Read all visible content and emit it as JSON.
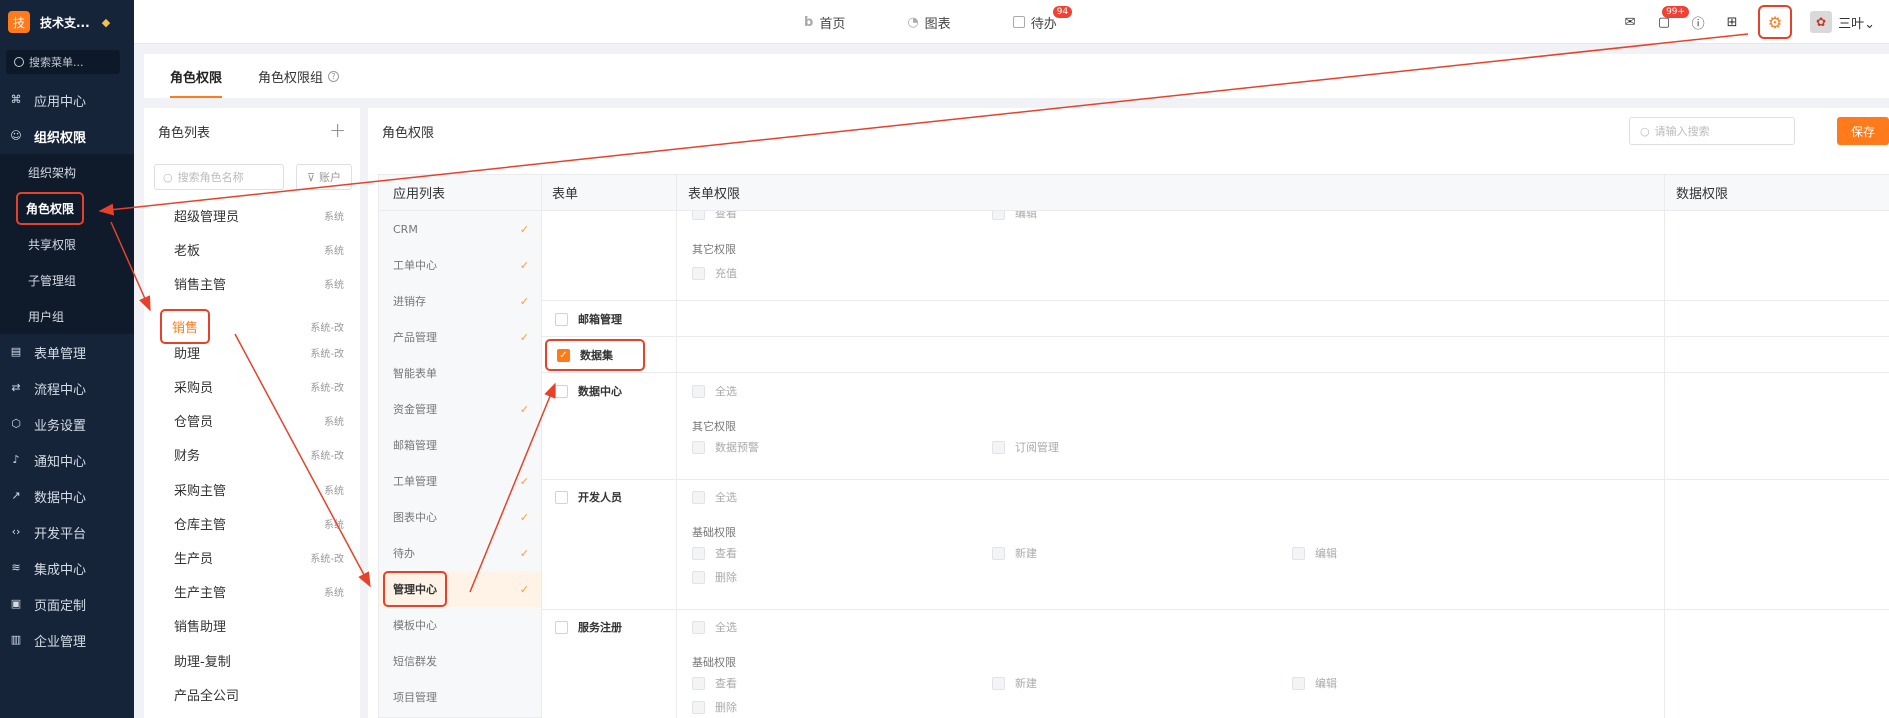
{
  "brand": {
    "logo": "技",
    "name": "技术支...",
    "badge_icon": "diamond-icon"
  },
  "sidebar": {
    "search_placeholder": "搜索菜单...",
    "items": [
      {
        "label": "应用中心",
        "icon": "apps-icon"
      },
      {
        "label": "组织权限",
        "icon": "user-icon"
      },
      {
        "label": "表单管理",
        "icon": "form-icon"
      },
      {
        "label": "流程中心",
        "icon": "flow-icon"
      },
      {
        "label": "业务设置",
        "icon": "cube-icon"
      },
      {
        "label": "通知中心",
        "icon": "bell-icon"
      },
      {
        "label": "数据中心",
        "icon": "chart-icon"
      },
      {
        "label": "开发平台",
        "icon": "code-icon"
      },
      {
        "label": "集成中心",
        "icon": "layers-icon"
      },
      {
        "label": "页面定制",
        "icon": "page-icon"
      },
      {
        "label": "企业管理",
        "icon": "building-icon"
      }
    ],
    "sub_items": [
      "组织架构",
      "角色权限",
      "共享权限",
      "子管理组",
      "用户组"
    ]
  },
  "topnav": {
    "items": [
      {
        "label": "首页",
        "icon": "home-icon"
      },
      {
        "label": "图表",
        "icon": "chart-icon"
      },
      {
        "label": "待办",
        "icon": "todo-icon",
        "badge": "94"
      }
    ],
    "message_badge": "99+",
    "user": "三叶"
  },
  "tabs": [
    "角色权限",
    "角色权限组"
  ],
  "roles": {
    "title": "角色列表",
    "search_placeholder": "搜索角色名称",
    "filter_label": "账户",
    "list": [
      {
        "name": "超级管理员",
        "type": "系统"
      },
      {
        "name": "老板",
        "type": "系统"
      },
      {
        "name": "销售主管",
        "type": "系统"
      },
      {
        "name": "销售",
        "type": "系统-改"
      },
      {
        "name": "助理",
        "type": "系统-改"
      },
      {
        "name": "采购员",
        "type": "系统-改"
      },
      {
        "name": "仓管员",
        "type": "系统"
      },
      {
        "name": "财务",
        "type": "系统-改"
      },
      {
        "name": "采购主管",
        "type": "系统"
      },
      {
        "name": "仓库主管",
        "type": "系统"
      },
      {
        "name": "生产员",
        "type": "系统-改"
      },
      {
        "name": "生产主管",
        "type": "系统"
      },
      {
        "name": "销售助理",
        "type": ""
      },
      {
        "name": "助理-复制",
        "type": ""
      },
      {
        "name": "产品全公司",
        "type": ""
      }
    ]
  },
  "main": {
    "title": "角色权限",
    "search_placeholder": "请输入搜索",
    "save_label": "保存",
    "applist_header": "应用列表",
    "apps": [
      {
        "name": "CRM",
        "checked": true
      },
      {
        "name": "工单中心",
        "checked": true
      },
      {
        "name": "进销存",
        "checked": true
      },
      {
        "name": "产品管理",
        "checked": true
      },
      {
        "name": "智能表单",
        "checked": false
      },
      {
        "name": "资金管理",
        "checked": true
      },
      {
        "name": "邮箱管理",
        "checked": false
      },
      {
        "name": "工单管理",
        "checked": true
      },
      {
        "name": "图表中心",
        "checked": true
      },
      {
        "name": "待办",
        "checked": true
      },
      {
        "name": "管理中心",
        "checked": true
      },
      {
        "name": "模板中心",
        "checked": false
      },
      {
        "name": "短信群发",
        "checked": false
      },
      {
        "name": "项目管理",
        "checked": false
      }
    ],
    "columns": {
      "form": "表单",
      "form_perm": "表单权限",
      "data_perm": "数据权限"
    },
    "rows": {
      "top_partial": {
        "p1": "查看",
        "p2": "编辑",
        "other": "其它权限",
        "recharge": "充值"
      },
      "mailbox": "邮箱管理",
      "dataset": "数据集",
      "datacenter": {
        "name": "数据中心",
        "all": "全选",
        "other": "其它权限",
        "warn": "数据预警",
        "sub": "订阅管理"
      },
      "developer": {
        "name": "开发人员",
        "all": "全选",
        "basic": "基础权限",
        "view": "查看",
        "new": "新建",
        "edit": "编辑",
        "del": "删除"
      },
      "service": {
        "name": "服务注册",
        "all": "全选",
        "basic": "基础权限",
        "view": "查看",
        "new": "新建",
        "edit": "编辑",
        "del": "删除"
      }
    }
  }
}
